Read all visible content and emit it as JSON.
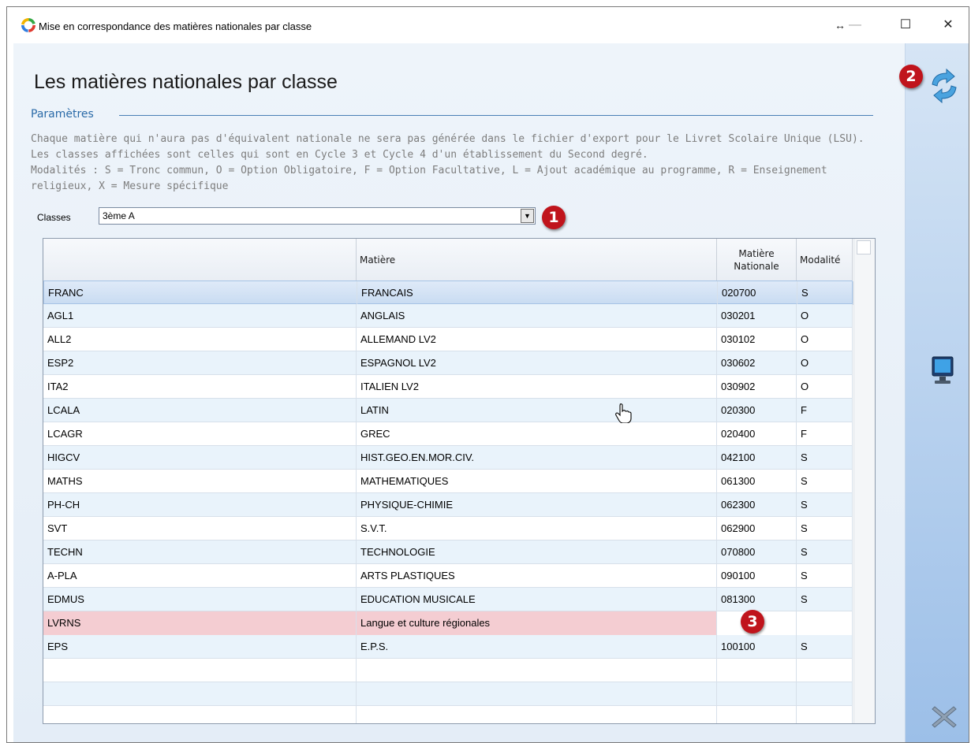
{
  "window": {
    "title": "Mise en correspondance des matières nationales par classe",
    "controls": {
      "resize": "↔",
      "dash": "—",
      "maximize": "☐",
      "close": "✕"
    }
  },
  "page_title": "Les matières nationales par classe",
  "params": {
    "label": "Paramètres",
    "lines": [
      "Chaque matière qui n'aura pas d'équivalent nationale ne sera pas générée dans le fichier d'export pour le Livret Scolaire Unique (LSU).",
      "Les classes affichées sont celles qui sont en Cycle 3 et Cycle 4 d'un établissement du Second degré.",
      "Modalités : S = Tronc commun, O = Option Obligatoire, F = Option Facultative, L = Ajout académique au programme, R = Enseignement",
      "religieux, X = Mesure spécifique"
    ]
  },
  "classes": {
    "label": "Classes",
    "value": "3ème A",
    "dropdown_glyph": "▼"
  },
  "badges": {
    "b1": "1",
    "b2": "2",
    "b3": "3"
  },
  "table": {
    "headers": {
      "code": "",
      "matiere": "Matière",
      "matiere_nationale_1": "Matière",
      "matiere_nationale_2": "Nationale",
      "modalite": "Modalité"
    },
    "rows": [
      {
        "code": "FRANC",
        "matiere": "FRANCAIS",
        "nationale": "020700",
        "modalite": "S"
      },
      {
        "code": "AGL1",
        "matiere": "ANGLAIS",
        "nationale": "030201",
        "modalite": "O"
      },
      {
        "code": "ALL2",
        "matiere": "ALLEMAND LV2",
        "nationale": "030102",
        "modalite": "O"
      },
      {
        "code": "ESP2",
        "matiere": "ESPAGNOL LV2",
        "nationale": "030602",
        "modalite": "O"
      },
      {
        "code": "ITA2",
        "matiere": "ITALIEN LV2",
        "nationale": "030902",
        "modalite": "O"
      },
      {
        "code": "LCALA",
        "matiere": "LATIN",
        "nationale": "020300",
        "modalite": "F"
      },
      {
        "code": "LCAGR",
        "matiere": "GREC",
        "nationale": "020400",
        "modalite": "F"
      },
      {
        "code": "HIGCV",
        "matiere": "HIST.GEO.EN.MOR.CIV.",
        "nationale": "042100",
        "modalite": "S"
      },
      {
        "code": "MATHS",
        "matiere": "MATHEMATIQUES",
        "nationale": "061300",
        "modalite": "S"
      },
      {
        "code": "PH-CH",
        "matiere": "PHYSIQUE-CHIMIE",
        "nationale": "062300",
        "modalite": "S"
      },
      {
        "code": "SVT",
        "matiere": "S.V.T.",
        "nationale": "062900",
        "modalite": "S"
      },
      {
        "code": "TECHN",
        "matiere": "TECHNOLOGIE",
        "nationale": "070800",
        "modalite": "S"
      },
      {
        "code": "A-PLA",
        "matiere": "ARTS PLASTIQUES",
        "nationale": "090100",
        "modalite": "S"
      },
      {
        "code": "EDMUS",
        "matiere": "EDUCATION MUSICALE",
        "nationale": "081300",
        "modalite": "S"
      },
      {
        "code": "LVRNS",
        "matiere": "Langue et culture régionales",
        "nationale": "",
        "modalite": ""
      },
      {
        "code": "EPS",
        "matiere": "E.P.S.",
        "nationale": "100100",
        "modalite": "S"
      },
      {
        "code": "",
        "matiere": "",
        "nationale": "",
        "modalite": ""
      },
      {
        "code": "",
        "matiere": "",
        "nationale": "",
        "modalite": ""
      },
      {
        "code": "",
        "matiere": "",
        "nationale": "",
        "modalite": ""
      }
    ]
  },
  "icons": {
    "refresh": "refresh-icon",
    "monitor": "monitor-icon",
    "close_tool": "close-tool-icon",
    "cursor": "hand-cursor-icon"
  },
  "colors": {
    "accent": "#2a6aa8",
    "badge": "#c0141c",
    "alert_row": "#f4cdd2",
    "row_alt": "#e9f3fb",
    "panel": "#9cbfe8"
  }
}
